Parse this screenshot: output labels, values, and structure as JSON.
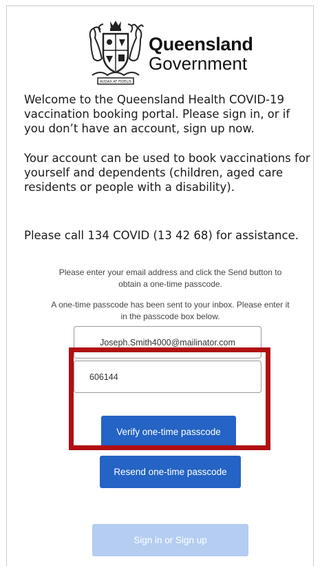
{
  "branding": {
    "title": "Queensland",
    "subtitle": "Government",
    "crest_motto": "AUDAX AT FIDELIS"
  },
  "intro": {
    "welcome": "Welcome to the Queensland Health COVID-19 vaccination booking portal. Please sign in, or if you don’t have an account, sign up now.",
    "account": "Your account can be used to book vaccinations for yourself and dependents (children, aged care residents or people with a disability).",
    "help": "Please call 134 COVID (13 42 68) for assistance."
  },
  "form": {
    "email_hint": "Please enter your email address and click the Send button to obtain a one-time passcode.",
    "passcode_sent": "A one-time passcode has been sent to your inbox. Please enter it in the passcode box below.",
    "email_value": "Joseph.Smith4000@mailinator.com",
    "passcode_value": "606144",
    "verify_label": "Verify one-time passcode",
    "resend_label": "Resend one-time passcode",
    "signin_label": "Sign in or Sign up"
  },
  "colors": {
    "primary_button": "#2563c4",
    "disabled_button": "#b4cdf0",
    "highlight_border": "#b10f12"
  }
}
